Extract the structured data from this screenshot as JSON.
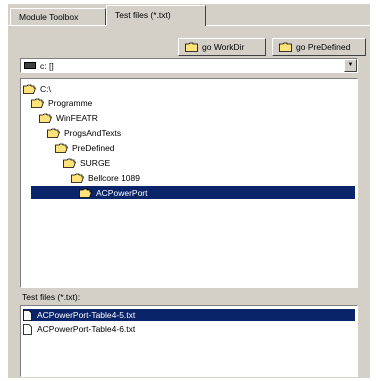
{
  "tabs": [
    {
      "label": "Module Toolbox"
    },
    {
      "label": "Test files (*.txt)"
    }
  ],
  "toolbar": {
    "go_workdir": "go WorkDir",
    "go_predefined": "go PreDefined"
  },
  "drive": {
    "value": "c: []"
  },
  "tree": [
    {
      "label": "C:\\"
    },
    {
      "label": "Programme"
    },
    {
      "label": "WinFEATR"
    },
    {
      "label": "ProgsAndTexts"
    },
    {
      "label": "PreDefined"
    },
    {
      "label": "SURGE"
    },
    {
      "label": "Bellcore 1089"
    },
    {
      "label": "ACPowerPort"
    }
  ],
  "files_label": "Test files (*.txt):",
  "files": [
    {
      "label": "ACPowerPort-Table4-5.txt"
    },
    {
      "label": "ACPowerPort-Table4-6.txt"
    }
  ],
  "colors": {
    "selection": "#0a246a",
    "folder": "#ffe37a",
    "face": "#d4d0c8"
  }
}
